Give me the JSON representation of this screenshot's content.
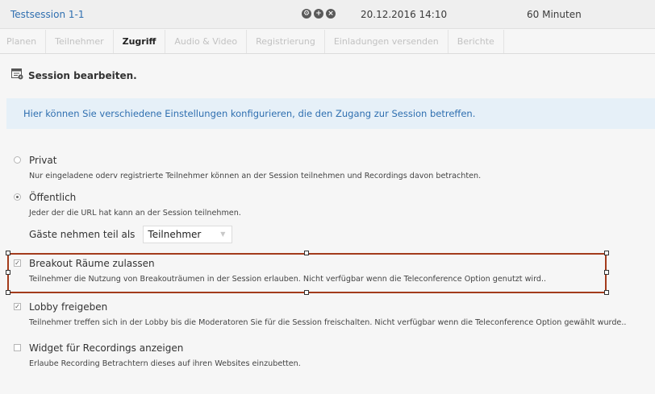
{
  "header": {
    "session_title": "Testsession 1-1",
    "icons": [
      "settings-icon",
      "add-icon",
      "close-icon"
    ],
    "date": "20.12.2016 14:10",
    "duration": "60 Minuten"
  },
  "tabs": [
    {
      "label": "Planen",
      "active": false
    },
    {
      "label": "Teilnehmer",
      "active": false
    },
    {
      "label": "Zugriff",
      "active": true
    },
    {
      "label": "Audio & Video",
      "active": false
    },
    {
      "label": "Registrierung",
      "active": false
    },
    {
      "label": "Einladungen versenden",
      "active": false
    },
    {
      "label": "Berichte",
      "active": false
    }
  ],
  "section": {
    "title": "Session bearbeiten.",
    "info": "Hier können Sie verschiedene Einstellungen konfigurieren, die den Zugang zur Session betreffen."
  },
  "options": {
    "privat": {
      "label": "Privat",
      "desc": "Nur eingeladene oderv registrierte Teilnehmer können an der Session teilnehmen und Recordings davon betrachten.",
      "selected": false
    },
    "oeffentlich": {
      "label": "Öffentlich",
      "desc": "Jeder der die URL hat kann an der Session teilnehmen.",
      "selected": true,
      "guest_label": "Gäste nehmen teil als",
      "guest_value": "Teilnehmer"
    },
    "breakout": {
      "label": "Breakout Räume zulassen",
      "desc": "Teilnehmer die Nutzung von Breakouträumen in der Session erlauben. Nicht verfügbar wenn die Teleconference Option genutzt wird..",
      "checked": true
    },
    "lobby": {
      "label": "Lobby freigeben",
      "desc": "Teilnehmer treffen sich in der Lobby bis die Moderatoren Sie für die Session freischalten. Nicht verfügbar wenn die Teleconference Option gewählt wurde..",
      "checked": true
    },
    "widget": {
      "label": "Widget für Recordings anzeigen",
      "desc": "Erlaube Recording Betrachtern dieses auf ihren Websites einzubetten.",
      "checked": false
    }
  },
  "colors": {
    "accent": "#2f6fb0",
    "info_bg": "#e6f0f8",
    "selection": "#a33b1c"
  }
}
